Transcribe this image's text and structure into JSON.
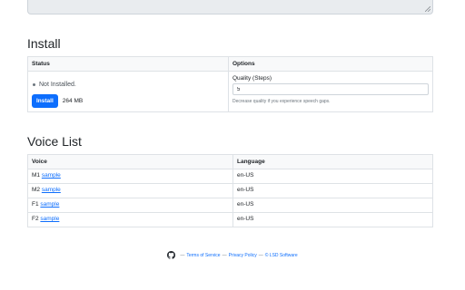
{
  "install": {
    "heading": "Install",
    "col_status": "Status",
    "col_options": "Options",
    "status_text": "Not Installed.",
    "install_button": "Install",
    "size": "264 MB",
    "quality_label": "Quality (Steps)",
    "quality_value": "5",
    "quality_help": "Decrease quality if you experience speech gaps."
  },
  "voice_list": {
    "heading": "Voice List",
    "col_voice": "Voice",
    "col_language": "Language",
    "rows": [
      {
        "voice": "M1",
        "link": "sample",
        "language": "en-US"
      },
      {
        "voice": "M2",
        "link": "sample",
        "language": "en-US"
      },
      {
        "voice": "F1",
        "link": "sample",
        "language": "en-US"
      },
      {
        "voice": "F2",
        "link": "sample",
        "language": "en-US"
      }
    ]
  },
  "footer": {
    "icon": "github-icon",
    "sep": "—",
    "terms": "Terms of Service",
    "privacy": "Privacy Policy",
    "company": "© LSD Software"
  }
}
